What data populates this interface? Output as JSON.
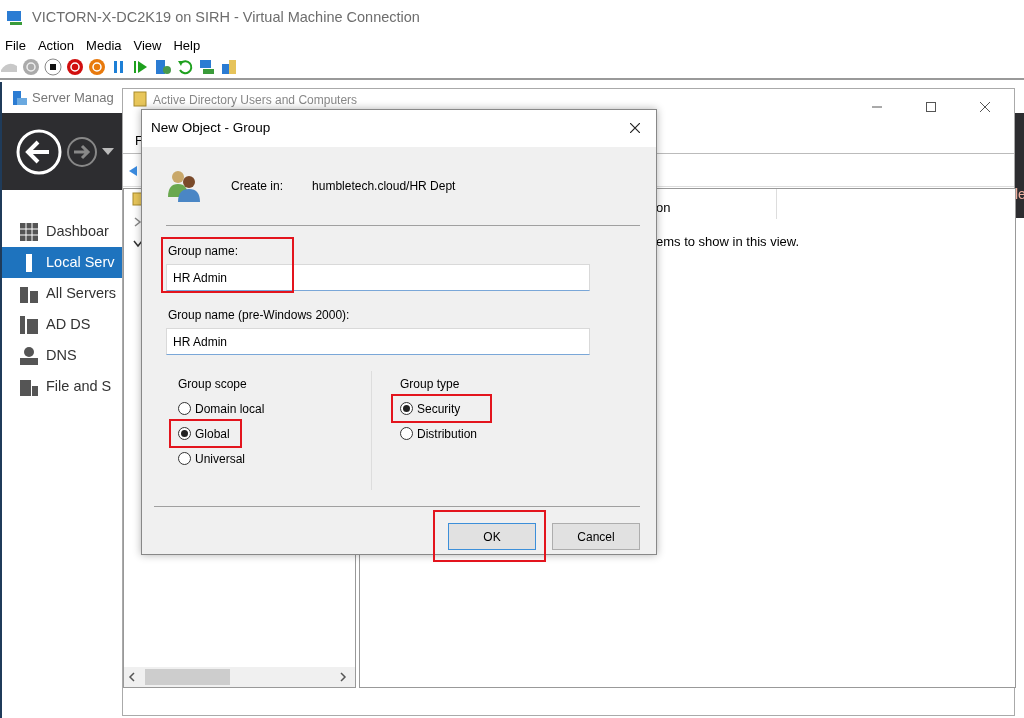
{
  "vm_window": {
    "title": "VICTORN-X-DC2K19 on SIRH - Virtual Machine Connection"
  },
  "menu": [
    "File",
    "Action",
    "Media",
    "View",
    "Help"
  ],
  "server_manager": {
    "title": "Server Manag",
    "sidebar": [
      {
        "label": "Dashboar",
        "selected": false
      },
      {
        "label": "Local Serv",
        "selected": true
      },
      {
        "label": "All Servers",
        "selected": false
      },
      {
        "label": "AD DS",
        "selected": false
      },
      {
        "label": "DNS",
        "selected": false
      },
      {
        "label": "File and S",
        "selected": false
      }
    ],
    "edge_fragment": "le"
  },
  "aduc": {
    "title": "Active Directory Users and Computers",
    "menu_fragment": "F",
    "column_fragment": "on",
    "empty_message_fragment": "ems to show in this view."
  },
  "dialog": {
    "title": "New Object - Group",
    "create_in_label": "Create in:",
    "create_in_path": "humbletech.cloud/HR Dept",
    "fields": [
      {
        "label": "Group name:",
        "value": "HR Admin",
        "highlighted": true
      },
      {
        "label": "Group name (pre-Windows 2000):",
        "value": "HR Admin",
        "highlighted": false
      }
    ],
    "groups": [
      {
        "title": "Group scope",
        "options": [
          {
            "label": "Domain local",
            "selected": false,
            "highlighted": false
          },
          {
            "label": "Global",
            "selected": true,
            "highlighted": true
          },
          {
            "label": "Universal",
            "selected": false,
            "highlighted": false
          }
        ]
      },
      {
        "title": "Group type",
        "options": [
          {
            "label": "Security",
            "selected": true,
            "highlighted": true
          },
          {
            "label": "Distribution",
            "selected": false,
            "highlighted": false
          }
        ]
      }
    ],
    "buttons": [
      {
        "label": "OK",
        "default": true,
        "highlighted": true
      },
      {
        "label": "Cancel",
        "default": false,
        "highlighted": false
      }
    ]
  }
}
